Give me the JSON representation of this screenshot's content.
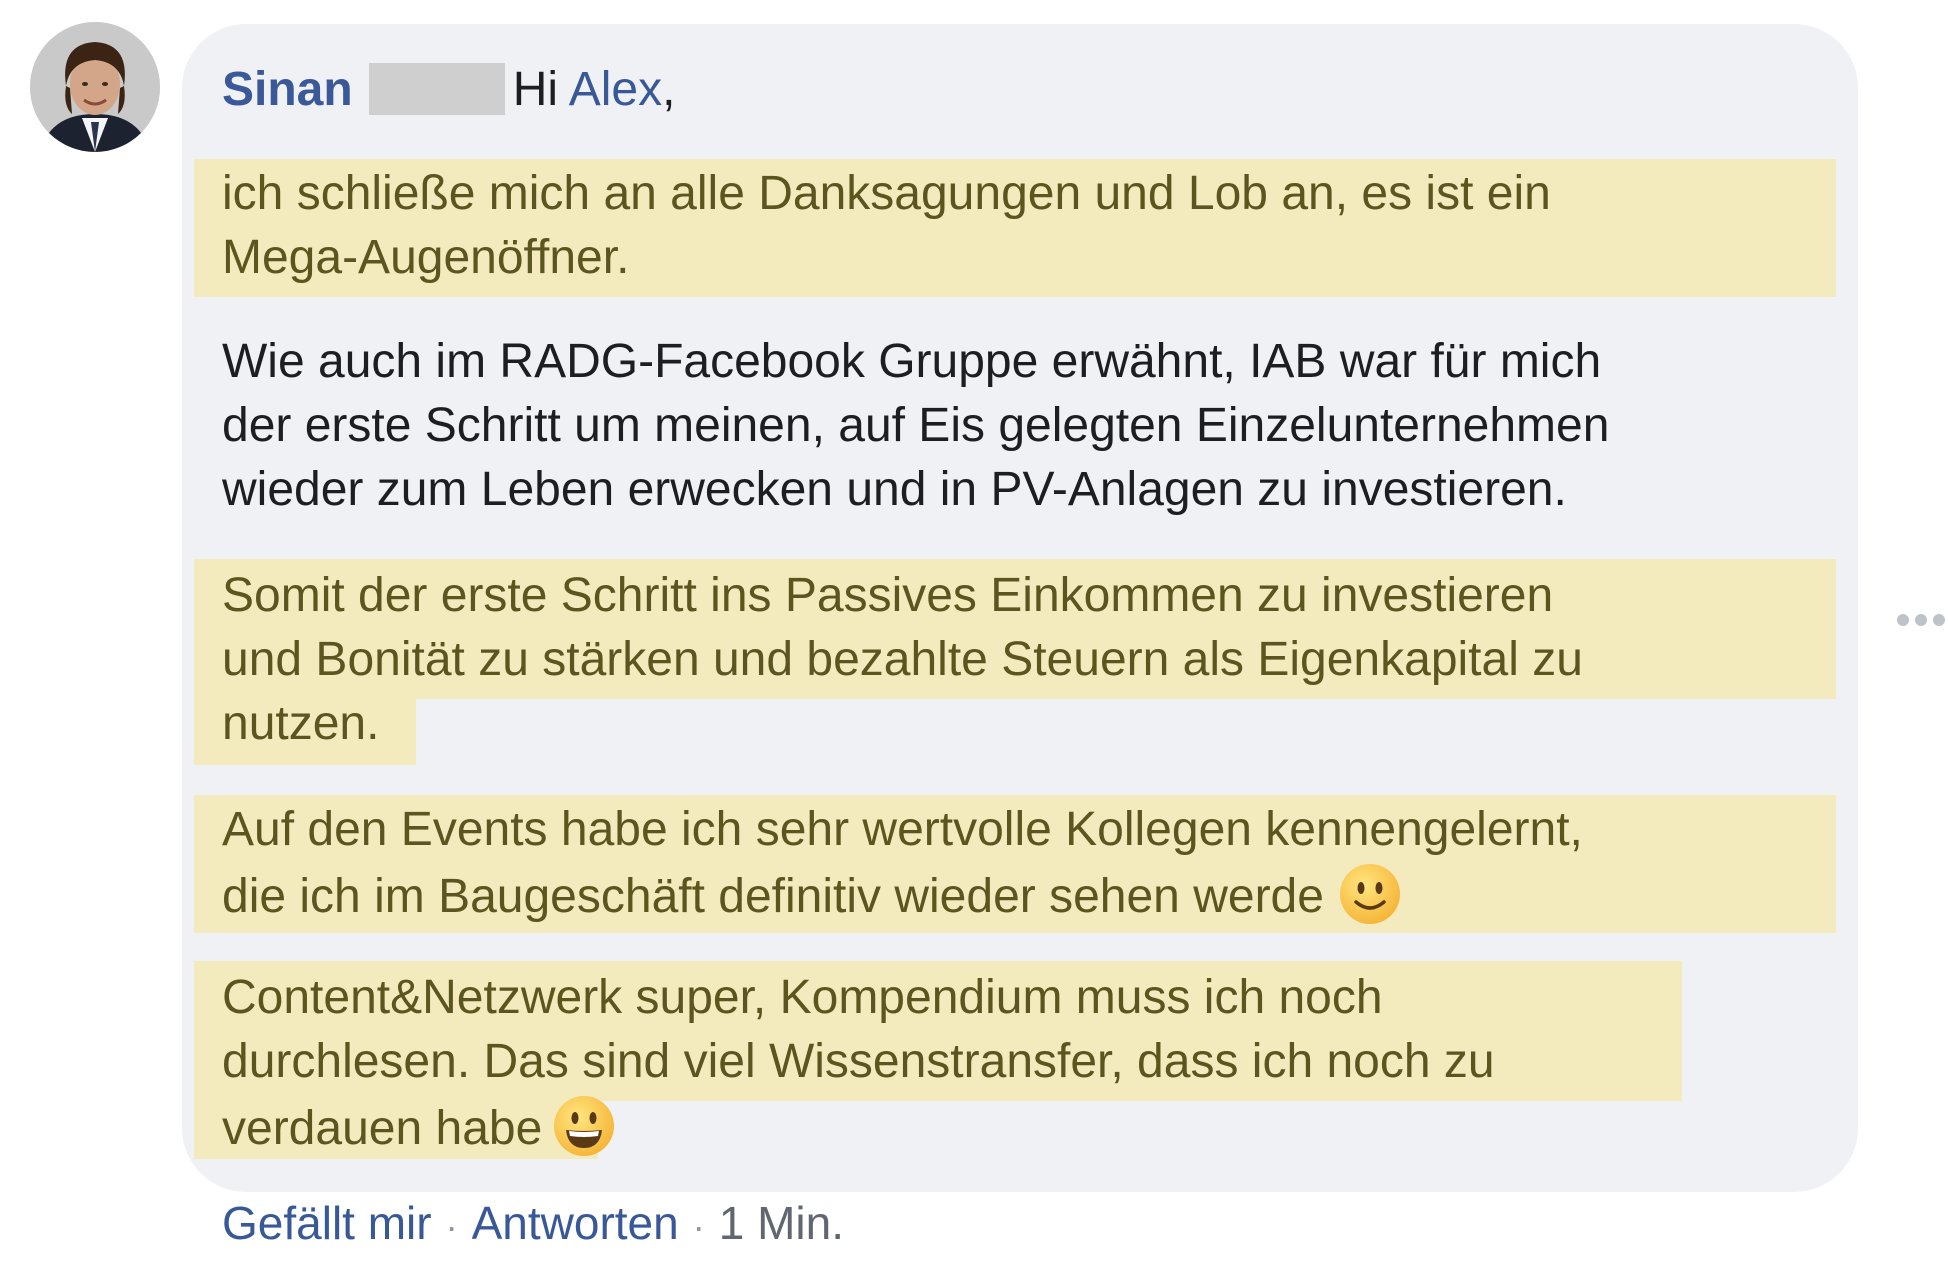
{
  "comment": {
    "author": "Sinan",
    "greeting": "Hi",
    "mention": "Alex",
    "greeting_end": ",",
    "paragraph1_line1": "ich schließe mich an alle Danksagungen und Lob an, es ist ein",
    "paragraph1_line2": "Mega-Augenöffner.",
    "paragraph2_line1": "Wie auch im RADG-Facebook Gruppe erwähnt, IAB war für mich",
    "paragraph2_line2": "der erste Schritt um meinen, auf Eis gelegten Einzelunternehmen",
    "paragraph2_line3": "wieder zum Leben erwecken und in PV-Anlagen zu investieren.",
    "paragraph3_line1": "Somit der erste Schritt ins Passives Einkommen zu investieren",
    "paragraph3_line2": "und Bonität zu stärken und bezahlte Steuern als Eigenkapital zu",
    "paragraph3_line3": "nutzen.",
    "paragraph4_line1": "Auf den Events habe ich sehr wertvolle Kollegen kennengelernt,",
    "paragraph4_line2": "die ich im Baugeschäft definitiv wieder sehen werde",
    "paragraph5_line1": "Content&Netzwerk super, Kompendium muss ich noch",
    "paragraph5_line2": "durchlesen. Das sind viel Wissenstransfer, dass ich noch zu",
    "paragraph5_line3": "verdauen habe"
  },
  "actions": {
    "like": "Gefällt mir",
    "separator": "·",
    "reply": "Antworten",
    "time": "1 Min."
  },
  "icons": {
    "avatar": "profile-photo",
    "emoji_smile": "slightly-smiling-face",
    "emoji_grin": "grinning-face",
    "more": "more-options-icon"
  },
  "colors": {
    "bubble": "#f0f1f4",
    "highlight": "#f3ebbd",
    "author": "#3b5998",
    "link": "#385898"
  }
}
